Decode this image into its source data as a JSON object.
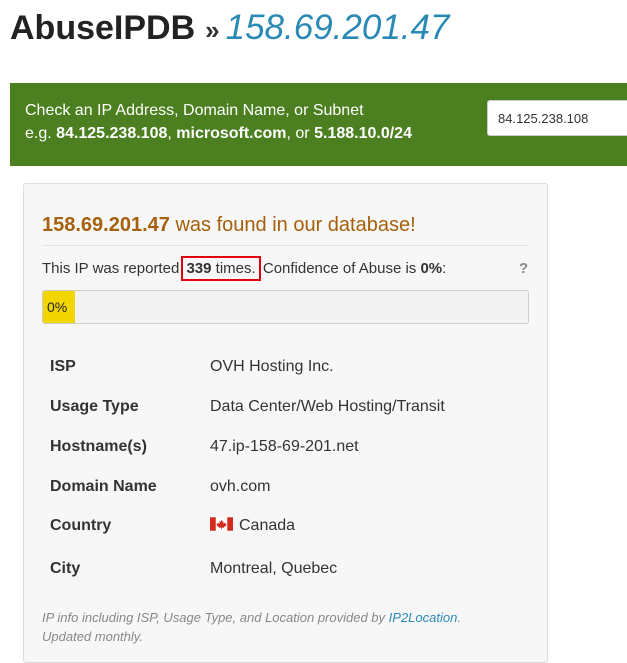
{
  "header": {
    "brand": "AbuseIPDB",
    "separator": "»",
    "ip": "158.69.201.47"
  },
  "banner": {
    "line1": "Check an IP Address, Domain Name, or Subnet",
    "line2_prefix": "e.g.",
    "ex1": "84.125.238.108",
    "comma1": ",",
    "ex2": "microsoft.com",
    "or_text": ", or",
    "ex3": "5.188.10.0/24",
    "search_value": "84.125.238.108"
  },
  "result": {
    "ip": "158.69.201.47",
    "found_suffix": "was found in our database!",
    "reported_prefix": "This IP was reported",
    "report_count": "339",
    "times": "times.",
    "confidence_prefix": "Confidence of Abuse is",
    "confidence": "0%",
    "confidence_suffix": ":",
    "help": "?",
    "progress_label": "0%",
    "progress_fraction": 0.0
  },
  "details": [
    {
      "key": "ISP",
      "value": "OVH Hosting Inc."
    },
    {
      "key": "Usage Type",
      "value": "Data Center/Web Hosting/Transit"
    },
    {
      "key": "Hostname(s)",
      "value": "47.ip-158-69-201.net"
    },
    {
      "key": "Domain Name",
      "value": "ovh.com"
    },
    {
      "key": "Country",
      "value": "Canada",
      "icon": "canada-flag-icon"
    },
    {
      "key": "City",
      "value": "Montreal, Quebec"
    }
  ],
  "footer": {
    "text_before": "IP info including ISP, Usage Type, and Location provided by",
    "link": "IP2Location",
    "text_after": ". Updated monthly."
  },
  "colors": {
    "banner": "#4b7f1f",
    "link": "#2a8ab6",
    "found": "#a65f0a",
    "progress": "#f2d600",
    "highlight": "#e1000f"
  }
}
